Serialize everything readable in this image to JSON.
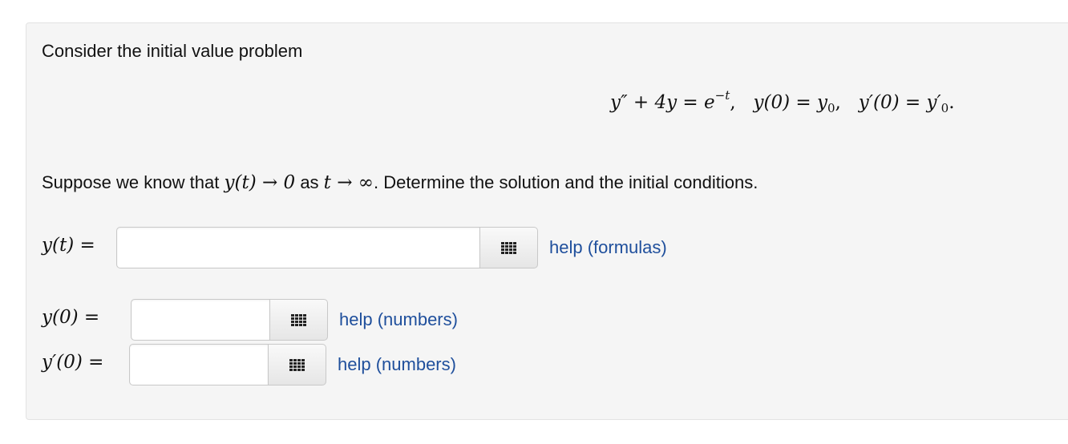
{
  "problem": {
    "intro": "Consider the initial value problem",
    "equation": {
      "lhs": "y″ + 4y = e",
      "exponent": "−t",
      "sep1": ",   ",
      "cond1_lhs": "y(0) = y",
      "cond1_sub": "0",
      "sep2": ",   ",
      "cond2_lhs": "y′(0) = y′",
      "cond2_sub": "0",
      "end": "."
    },
    "condition": {
      "prefix": "Suppose we know that ",
      "math1": "y(t) → 0",
      "mid": " as ",
      "math2": "t → ∞",
      "suffix": ". Determine the solution and the initial conditions."
    }
  },
  "answers": {
    "y_t": {
      "label": "y(t) =",
      "value": "",
      "help": "help (formulas)"
    },
    "y_0": {
      "label": "y(0) =",
      "value": "",
      "help": "help (numbers)"
    },
    "yp_0": {
      "label": "y′(0) =",
      "value": "",
      "help": "help (numbers)"
    }
  },
  "icons": {
    "equation_editor": "grid-icon"
  },
  "colors": {
    "panel_background": "#f5f5f5",
    "link": "#1f4f9c"
  }
}
